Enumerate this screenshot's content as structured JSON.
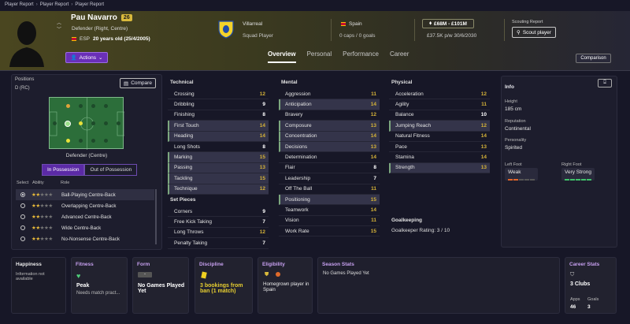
{
  "breadcrumb": [
    "Player Report",
    "Player Report",
    "Player Report"
  ],
  "player": {
    "name": "Pau Navarro",
    "number": "26",
    "position": "Defender (Right, Centre)",
    "nation_code": "ESP",
    "age": "20 years old (25/4/2005)"
  },
  "actions_label": "Actions",
  "club": {
    "name": "Villarreal",
    "status": "Squad Player"
  },
  "country": {
    "name": "Spain",
    "caps": "0 caps / 0 goals"
  },
  "value": {
    "range": "£68M - £101M",
    "wage": "£37.5K p/w 30/6/2030"
  },
  "scouting": {
    "label": "Scouting Report",
    "button": "Scout player"
  },
  "tabs": [
    "Overview",
    "Personal",
    "Performance",
    "Career"
  ],
  "comparison_label": "Comparison",
  "positions": {
    "label": "Positions",
    "value": "D (RC)",
    "compare": "Compare",
    "role_name": "Defender (Centre)",
    "in_possession": "In Possession",
    "out_possession": "Out of Possession"
  },
  "roles_header": {
    "select": "Select",
    "ability": "Ability",
    "role": "Role"
  },
  "roles": [
    {
      "name": "Ball-Playing Centre-Back",
      "stars": 2,
      "selected": true
    },
    {
      "name": "Overlapping Centre-Back",
      "stars": 2,
      "selected": false
    },
    {
      "name": "Advanced Centre-Back",
      "stars": 2,
      "selected": false
    },
    {
      "name": "Wide Centre-Back",
      "stars": 2,
      "selected": false
    },
    {
      "name": "No-Nonsense Centre-Back",
      "stars": 2,
      "selected": false
    }
  ],
  "technical": {
    "title": "Technical",
    "items": [
      {
        "n": "Crossing",
        "v": "12"
      },
      {
        "n": "Dribbling",
        "v": "9"
      },
      {
        "n": "Finishing",
        "v": "8"
      },
      {
        "n": "First Touch",
        "v": "14"
      },
      {
        "n": "Heading",
        "v": "14"
      },
      {
        "n": "Long Shots",
        "v": "8"
      },
      {
        "n": "Marking",
        "v": "15"
      },
      {
        "n": "Passing",
        "v": "13"
      },
      {
        "n": "Tackling",
        "v": "15"
      },
      {
        "n": "Technique",
        "v": "12"
      }
    ]
  },
  "set_pieces": {
    "title": "Set Pieces",
    "items": [
      {
        "n": "Corners",
        "v": "9"
      },
      {
        "n": "Free Kick Taking",
        "v": "7"
      },
      {
        "n": "Long Throws",
        "v": "12"
      },
      {
        "n": "Penalty Taking",
        "v": "7"
      }
    ]
  },
  "mental": {
    "title": "Mental",
    "items": [
      {
        "n": "Aggression",
        "v": "11"
      },
      {
        "n": "Anticipation",
        "v": "14"
      },
      {
        "n": "Bravery",
        "v": "12"
      },
      {
        "n": "Composure",
        "v": "13"
      },
      {
        "n": "Concentration",
        "v": "14"
      },
      {
        "n": "Decisions",
        "v": "13"
      },
      {
        "n": "Determination",
        "v": "14"
      },
      {
        "n": "Flair",
        "v": "8"
      },
      {
        "n": "Leadership",
        "v": "7"
      },
      {
        "n": "Off The Ball",
        "v": "11"
      },
      {
        "n": "Positioning",
        "v": "15"
      },
      {
        "n": "Teamwork",
        "v": "14"
      },
      {
        "n": "Vision",
        "v": "11"
      },
      {
        "n": "Work Rate",
        "v": "15"
      }
    ]
  },
  "physical": {
    "title": "Physical",
    "items": [
      {
        "n": "Acceleration",
        "v": "12"
      },
      {
        "n": "Agility",
        "v": "11"
      },
      {
        "n": "Balance",
        "v": "10"
      },
      {
        "n": "Jumping Reach",
        "v": "12"
      },
      {
        "n": "Natural Fitness",
        "v": "14"
      },
      {
        "n": "Pace",
        "v": "13"
      },
      {
        "n": "Stamina",
        "v": "14"
      },
      {
        "n": "Strength",
        "v": "13"
      }
    ]
  },
  "goalkeeping": {
    "title": "Goalkeeping",
    "rating": "Goalkeeper Rating: 3 / 10"
  },
  "info": {
    "title": "Info",
    "height_label": "Height",
    "height": "185 cm",
    "reputation_label": "Reputation",
    "reputation": "Continental",
    "personality_label": "Personality",
    "personality": "Spirited",
    "left_foot_label": "Left Foot",
    "left_foot": "Weak",
    "right_foot_label": "Right Foot",
    "right_foot": "Very Strong"
  },
  "footer": {
    "happiness": {
      "title": "Happiness",
      "text": "Information not available"
    },
    "fitness": {
      "title": "Fitness",
      "value": "Peak",
      "sub": "Needs match pract..."
    },
    "form": {
      "title": "Form",
      "badge": "-",
      "value": "No Games Played Yet"
    },
    "discipline": {
      "title": "Discipline",
      "value": "3 bookings from ban (1 match)"
    },
    "eligibility": {
      "title": "Eligibility",
      "value": "Homegrown player in Spain"
    },
    "season": {
      "title": "Season Stats",
      "value": "No Games Played Yet"
    },
    "career": {
      "title": "Career Stats",
      "value": "3 Clubs",
      "apps_label": "Apps",
      "apps": "46",
      "goals_label": "Goals",
      "goals": "3"
    }
  },
  "colors": {
    "accent": "#6a2fb8",
    "gold": "#d6b338",
    "pitch": "#2c6e3a"
  }
}
